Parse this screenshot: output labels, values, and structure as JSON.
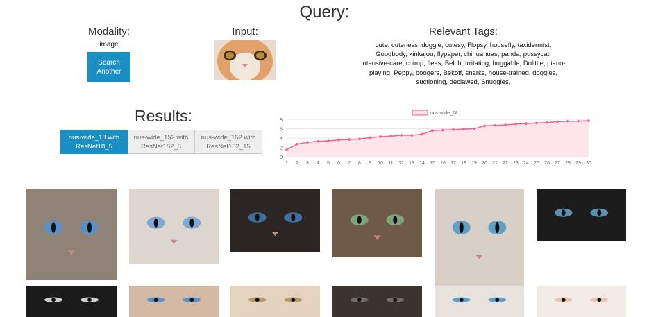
{
  "query": {
    "title": "Query:",
    "modality_label": "Modality:",
    "modality_value": "image",
    "search_button": "Search Another",
    "input_label": "Input:",
    "tags_label": "Relevant Tags:",
    "tags_text": "cute, cuteness, doggie, cutesy, Flopsy, housefly, taxidermist, Goodbody, kinkajou, flypaper, chihuahuas, panda, pussycat, intensive-care, chimp, fleas, Belch, Irritating, huggable, Dolittle, piano-playing, Peppy, boogers, Bekoff, snarks, house-trained, doggies, suctioning, declawed, Snuggles,"
  },
  "results": {
    "title": "Results:",
    "tabs": [
      {
        "label": "nus-wide_18 with ResNet18_5",
        "active": true
      },
      {
        "label": "nus-wide_152 with ResNet152_5",
        "active": false
      },
      {
        "label": "nus-wide_152 with ResNet152_15",
        "active": false
      }
    ]
  },
  "chart_data": {
    "type": "area",
    "series": [
      {
        "name": "nus-wide_18",
        "values": [
          1.5,
          2.7,
          3.1,
          3.3,
          3.4,
          3.6,
          3.7,
          3.8,
          4.1,
          4.3,
          4.4,
          4.6,
          4.6,
          4.8,
          5.6,
          5.7,
          5.8,
          5.9,
          6.0,
          6.6,
          6.7,
          6.8,
          7.0,
          7.1,
          7.2,
          7.3,
          7.5,
          7.6,
          7.6,
          7.7
        ]
      }
    ],
    "x": [
      1,
      2,
      3,
      4,
      5,
      6,
      7,
      8,
      9,
      10,
      11,
      12,
      13,
      14,
      15,
      16,
      17,
      18,
      19,
      20,
      21,
      22,
      23,
      24,
      25,
      26,
      27,
      28,
      29,
      30
    ],
    "y_ticks": [
      0,
      2,
      4,
      6,
      8
    ],
    "ylim": [
      0,
      8
    ],
    "legend_position": "top-center",
    "colors": {
      "line": "#f06292",
      "fill": "#fde0e8"
    }
  },
  "gallery": {
    "images": [
      {
        "label": "cat-blue-eyes-tabby"
      },
      {
        "label": "cat-fluffy-white-blue-eyes"
      },
      {
        "label": "cat-dark-siamese"
      },
      {
        "label": "cat-tabby-closeup"
      },
      {
        "label": "cat-white-blue-eyes-tall"
      },
      {
        "label": "cat-eyes-dark-strip"
      },
      {
        "label": "cat-black-partial"
      },
      {
        "label": "cat-ragdoll-partial"
      },
      {
        "label": "cat-golden-eyes-partial"
      },
      {
        "label": "cat-dark-partial"
      },
      {
        "label": "cat-white-partial"
      },
      {
        "label": "kitten-on-blanket"
      }
    ]
  }
}
